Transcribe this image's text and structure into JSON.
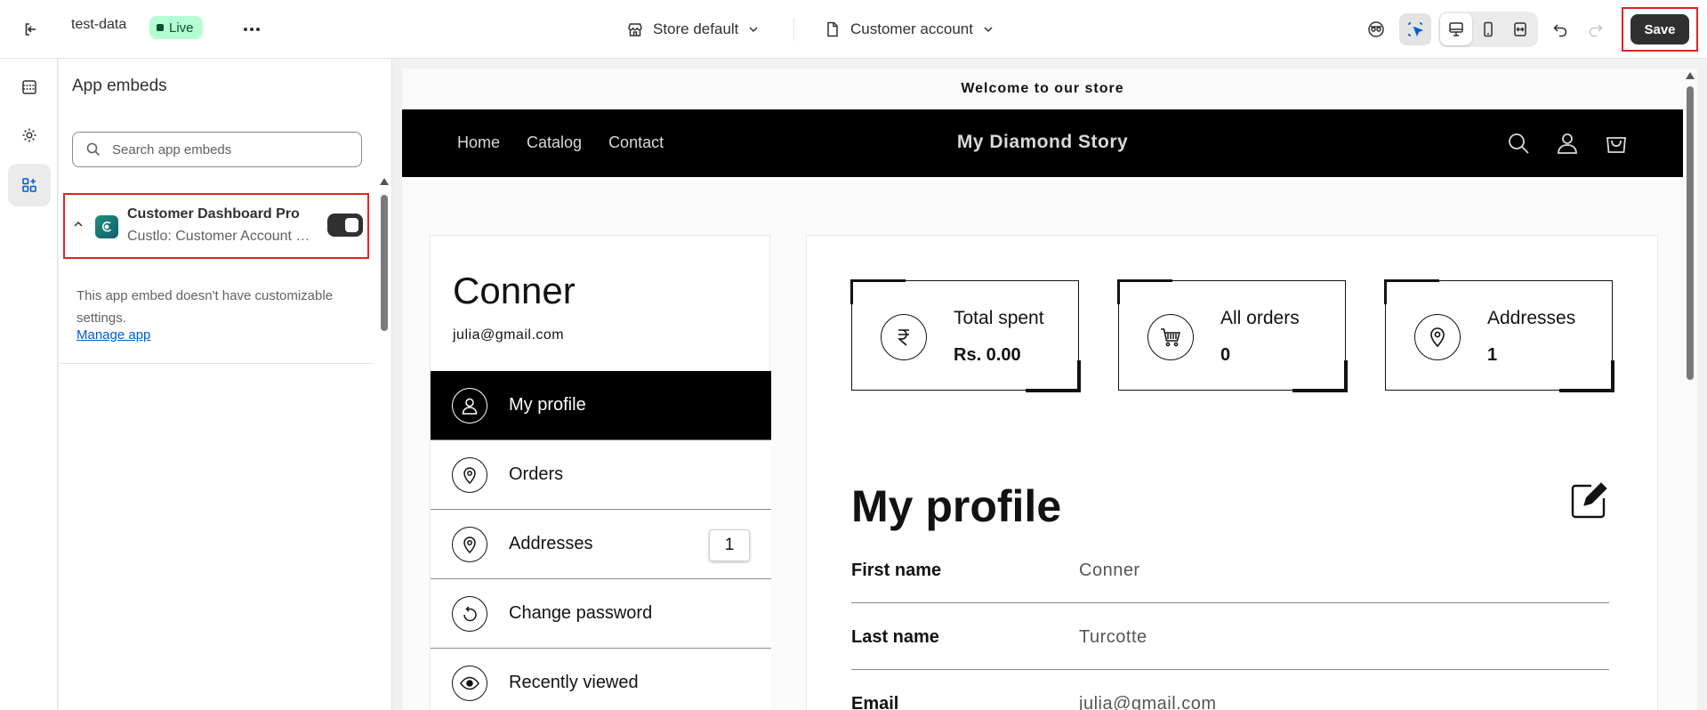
{
  "topbar": {
    "theme_name": "test-data",
    "status_badge": "Live",
    "context_select": "Store default",
    "page_select": "Customer account",
    "save_label": "Save"
  },
  "panel": {
    "title": "App embeds",
    "search_placeholder": "Search app embeds",
    "embed": {
      "name": "Customer Dashboard Pro",
      "subtitle": "Custlo: Customer Account Page",
      "enabled": true
    },
    "note": "This app embed doesn't have customizable settings.",
    "manage_link": "Manage app"
  },
  "preview": {
    "announcement": "Welcome to our store",
    "nav": [
      "Home",
      "Catalog",
      "Contact"
    ],
    "brand": "My Diamond Story",
    "customer": {
      "name": "Conner",
      "email": "julia@gmail.com"
    },
    "menu": [
      {
        "label": "My profile",
        "icon": "user-icon",
        "active": true
      },
      {
        "label": "Orders",
        "icon": "location-pin-icon"
      },
      {
        "label": "Addresses",
        "icon": "location-pin-icon",
        "count": "1"
      },
      {
        "label": "Change password",
        "icon": "refresh-icon"
      },
      {
        "label": "Recently viewed",
        "icon": "eye-icon"
      }
    ],
    "stats": [
      {
        "label": "Total spent",
        "value": "Rs. 0.00",
        "icon": "rupee-icon"
      },
      {
        "label": "All orders",
        "value": "0",
        "icon": "cart-icon"
      },
      {
        "label": "Addresses",
        "value": "1",
        "icon": "location-pin-icon"
      }
    ],
    "profile_title": "My profile",
    "fields": [
      {
        "label": "First name",
        "value": "Conner"
      },
      {
        "label": "Last name",
        "value": "Turcotte"
      },
      {
        "label": "Email",
        "value": "julia@gmail.com"
      }
    ]
  },
  "colors": {
    "accent_black": "#000000",
    "highlight_red": "#e02424",
    "live_green": "#b4fed2",
    "link_blue": "#005bd3"
  }
}
